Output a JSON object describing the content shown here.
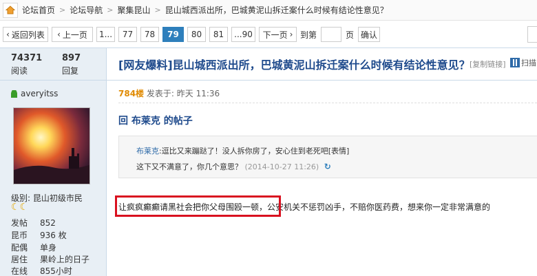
{
  "breadcrumb": {
    "items": [
      "论坛首页",
      "论坛导航",
      "聚集昆山",
      "昆山城西派出所，巴城黄泥山拆迁案什么时候有结论性意见？"
    ],
    "separator": ">"
  },
  "pager": {
    "back": "返回列表",
    "prev": "上一页",
    "pages": [
      "1...",
      "77",
      "78",
      "79",
      "80",
      "81",
      "...90"
    ],
    "current": "79",
    "next": "下一页",
    "goto_label": "到第",
    "page_unit": "页",
    "confirm": "确认"
  },
  "thread": {
    "views": "74371",
    "views_label": "阅读",
    "replies": "897",
    "replies_label": "回复",
    "title": "[网友爆料]昆山城西派出所，巴城黄泥山拆迁案什么时候有结论性意见？",
    "copy_link": "[复制链接]",
    "scan": "扫描"
  },
  "user": {
    "name": "averyitss",
    "level": "级别: 昆山初级市民",
    "fields": [
      {
        "k": "发帖",
        "v": "852"
      },
      {
        "k": "昆币",
        "v": "936 枚"
      },
      {
        "k": "配偶",
        "v": "单身"
      },
      {
        "k": "居住",
        "v": "果岭上的日子"
      },
      {
        "k": "在线",
        "v": "855小时"
      }
    ]
  },
  "post": {
    "floor": "784楼",
    "posted": "发表于: 昨天 11:36",
    "reply_title": "回 布莱克 的帖子",
    "quote_name": "布莱克",
    "quote_text": ":逗比又来蹦跶了！没人拆你房了，安心住到老死吧[表情]",
    "quote_line2": "这下又不满意了，你几个意思？",
    "quote_time": "(2014-10-27 11:26)",
    "body": "让疯疯癫癫请黑社会把你父母围殴一顿，公安机关不惩罚凶手，不赔你医药费，想来你一定非常满意的"
  },
  "colors": {
    "accent": "#2e7fbc",
    "title": "#1e4a8c",
    "highlight_box": "#d9101f",
    "floor": "#e08a00"
  }
}
